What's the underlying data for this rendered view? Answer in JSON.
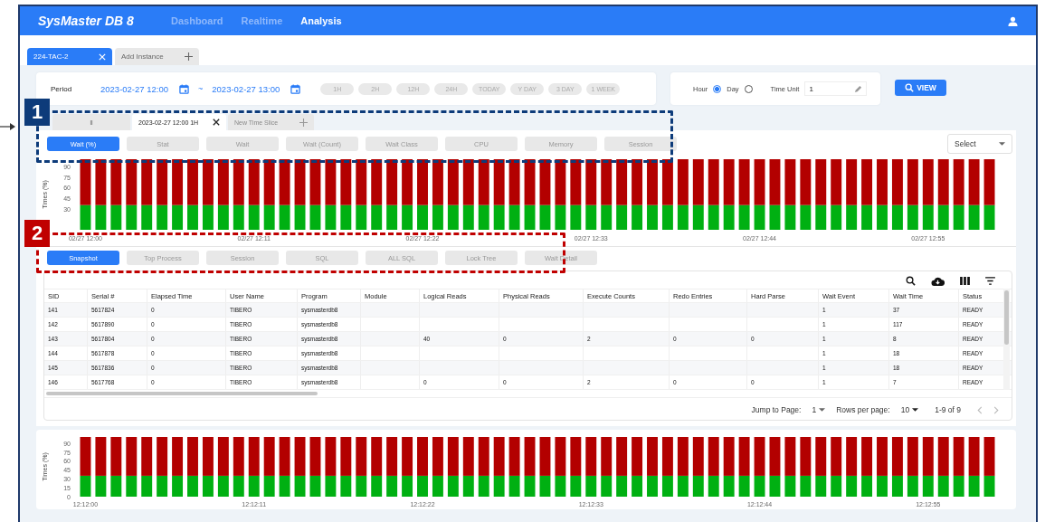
{
  "app": {
    "logo": "SysMaster DB 8",
    "nav": [
      {
        "label": "Dashboard",
        "selected": false
      },
      {
        "label": "Realtime",
        "selected": false
      },
      {
        "label": "Analysis",
        "selected": true
      }
    ]
  },
  "instance_tabs": [
    {
      "kind": "tab",
      "label": "224-TAC-2",
      "selected": true
    },
    {
      "kind": "add",
      "label": "Add Instance",
      "selected": false
    }
  ],
  "period": {
    "label": "Period",
    "start": "2023-02-27 12:00",
    "separator": "~",
    "end": "2023-02-27 13:00",
    "presets": [
      "1H",
      "2H",
      "12H",
      "24H",
      "TODAY",
      "Y DAY",
      "3 DAY",
      "1 WEEK"
    ]
  },
  "time_unit": {
    "options": [
      {
        "label": "Hour",
        "selected": true
      },
      {
        "label": "Day",
        "selected": false
      }
    ],
    "label": "Time Unit",
    "value": "1"
  },
  "view_button": "VIEW",
  "time_slices": [
    {
      "kind": "tab",
      "label": "ll",
      "selected": false
    },
    {
      "kind": "tab",
      "label": "2023-02-27 12:00 1H",
      "selected": true
    },
    {
      "kind": "add",
      "label": "New Time Slice",
      "selected": false
    }
  ],
  "metric_tabs": [
    {
      "label": "Wait (%)",
      "selected": true
    },
    {
      "label": "Stat",
      "selected": false
    },
    {
      "label": "Wait",
      "selected": false
    },
    {
      "label": "Wait (Count)",
      "selected": false
    },
    {
      "label": "Wait Class",
      "selected": false
    },
    {
      "label": "CPU",
      "selected": false
    },
    {
      "label": "Memory",
      "selected": false
    },
    {
      "label": "Session",
      "selected": false
    }
  ],
  "dropdown": {
    "label": "Select"
  },
  "top_chart": {
    "chart_data": {
      "type": "bar",
      "stacked": true,
      "ylabel": "Times (%)",
      "ylim": [
        0,
        100
      ],
      "yticks": [
        30,
        45,
        60,
        75,
        90
      ],
      "categories": [
        "02/27 12:00",
        null,
        null,
        null,
        null,
        null,
        null,
        null,
        null,
        null,
        null,
        "02/27 12:11",
        null,
        null,
        null,
        null,
        null,
        null,
        null,
        null,
        null,
        null,
        "02/27 12:22",
        null,
        null,
        null,
        null,
        null,
        null,
        null,
        null,
        null,
        null,
        "02/27 12:33",
        null,
        null,
        null,
        null,
        null,
        null,
        null,
        null,
        null,
        null,
        "02/27 12:44",
        null,
        null,
        null,
        null,
        null,
        null,
        null,
        null,
        null,
        null,
        "02/27 12:55",
        null,
        null,
        null,
        null
      ],
      "series": [
        {
          "color": "#00b012",
          "values": [
            35,
            35,
            35,
            35,
            35,
            35,
            35,
            35,
            35,
            35,
            35,
            35,
            35,
            35,
            35,
            35,
            35,
            35,
            35,
            35,
            35,
            35,
            35,
            35,
            35,
            35,
            35,
            35,
            35,
            35,
            35,
            35,
            35,
            35,
            35,
            35,
            35,
            35,
            35,
            35,
            35,
            35,
            35,
            35,
            35,
            35,
            35,
            35,
            35,
            35,
            35,
            35,
            35,
            35,
            35,
            35,
            35,
            35,
            35,
            35
          ]
        },
        {
          "color": "#b30000",
          "values": [
            65,
            65,
            65,
            65,
            65,
            65,
            65,
            65,
            65,
            65,
            65,
            65,
            65,
            65,
            65,
            65,
            65,
            65,
            65,
            65,
            65,
            65,
            65,
            65,
            65,
            65,
            65,
            65,
            65,
            65,
            65,
            65,
            65,
            65,
            65,
            65,
            65,
            65,
            65,
            65,
            65,
            65,
            65,
            65,
            65,
            65,
            65,
            65,
            65,
            65,
            65,
            65,
            65,
            65,
            65,
            65,
            65,
            65,
            65,
            65
          ]
        }
      ]
    }
  },
  "detail_tabs": [
    {
      "label": "Snapshot",
      "selected": true
    },
    {
      "label": "Top Process",
      "selected": false
    },
    {
      "label": "Session",
      "selected": false
    },
    {
      "label": "SQL",
      "selected": false
    },
    {
      "label": "ALL SQL",
      "selected": false
    },
    {
      "label": "Lock Tree",
      "selected": false
    },
    {
      "label": "Wait Detail",
      "selected": false
    }
  ],
  "table": {
    "columns": [
      "SID",
      "Serial #",
      "Elapsed Time",
      "User Name",
      "Program",
      "Module",
      "Logical Reads",
      "Physical Reads",
      "Execute Counts",
      "Redo Entries",
      "Hard Parse",
      "Wait Event",
      "Wait Time",
      "Status"
    ],
    "rows": [
      [
        "141",
        "5617824",
        "0",
        "TIBERO",
        "sysmasterdb8",
        null,
        null,
        null,
        null,
        null,
        null,
        "1",
        "37",
        "READY"
      ],
      [
        "142",
        "5617890",
        "0",
        "TIBERO",
        "sysmasterdb8",
        null,
        null,
        null,
        null,
        null,
        null,
        "1",
        "117",
        "READY"
      ],
      [
        "143",
        "5617804",
        "0",
        "TIBERO",
        "sysmasterdb8",
        null,
        "40",
        "0",
        "2",
        "0",
        "0",
        "1",
        "8",
        "READY"
      ],
      [
        "144",
        "5617878",
        "0",
        "TIBERO",
        "sysmasterdb8",
        null,
        null,
        null,
        null,
        null,
        null,
        "1",
        "18",
        "READY"
      ],
      [
        "145",
        "5617836",
        "0",
        "TIBERO",
        "sysmasterdb8",
        null,
        null,
        null,
        null,
        null,
        null,
        "1",
        "18",
        "READY"
      ],
      [
        "146",
        "5617768",
        "0",
        "TIBERO",
        "sysmasterdb8",
        null,
        "0",
        "0",
        "2",
        "0",
        "0",
        "1",
        "7",
        "READY"
      ]
    ]
  },
  "pagination": {
    "jump_label": "Jump to Page:",
    "page": "1",
    "rows_label": "Rows per page:",
    "rows": "10",
    "range": "1-9 of 9"
  },
  "bottom_chart": {
    "chart_data": {
      "type": "bar",
      "stacked": true,
      "ylabel": "Times (%)",
      "ylim": [
        0,
        100
      ],
      "yticks": [
        0,
        15,
        30,
        45,
        60,
        75,
        90
      ],
      "categories": [
        "12:12:00",
        null,
        null,
        null,
        null,
        null,
        null,
        null,
        null,
        null,
        null,
        "12:12:11",
        null,
        null,
        null,
        null,
        null,
        null,
        null,
        null,
        null,
        null,
        "12:12:22",
        null,
        null,
        null,
        null,
        null,
        null,
        null,
        null,
        null,
        null,
        "12:12:33",
        null,
        null,
        null,
        null,
        null,
        null,
        null,
        null,
        null,
        null,
        "12:12:44",
        null,
        null,
        null,
        null,
        null,
        null,
        null,
        null,
        null,
        null,
        "12:12:55",
        null,
        null,
        null,
        null
      ],
      "series": [
        {
          "color": "#00b012",
          "values": [
            35,
            35,
            35,
            35,
            35,
            35,
            35,
            35,
            35,
            35,
            35,
            35,
            35,
            35,
            35,
            35,
            35,
            35,
            35,
            35,
            35,
            35,
            35,
            35,
            35,
            35,
            35,
            35,
            35,
            35,
            35,
            35,
            35,
            35,
            35,
            35,
            35,
            35,
            35,
            35,
            35,
            35,
            35,
            35,
            35,
            35,
            35,
            35,
            35,
            35,
            35,
            35,
            35,
            35,
            35,
            35,
            35,
            35,
            35,
            35
          ]
        },
        {
          "color": "#b30000",
          "values": [
            65,
            65,
            65,
            65,
            65,
            65,
            65,
            65,
            65,
            65,
            65,
            65,
            65,
            65,
            65,
            65,
            65,
            65,
            65,
            65,
            65,
            65,
            65,
            65,
            65,
            65,
            65,
            65,
            65,
            65,
            65,
            65,
            65,
            65,
            65,
            65,
            65,
            65,
            65,
            65,
            65,
            65,
            65,
            65,
            65,
            65,
            65,
            65,
            65,
            65,
            65,
            65,
            65,
            65,
            65,
            65,
            65,
            65,
            65,
            65
          ]
        }
      ]
    }
  },
  "annotations": [
    {
      "label": "1",
      "color": "#0d3b7a"
    },
    {
      "label": "2",
      "color": "#c00000"
    }
  ]
}
